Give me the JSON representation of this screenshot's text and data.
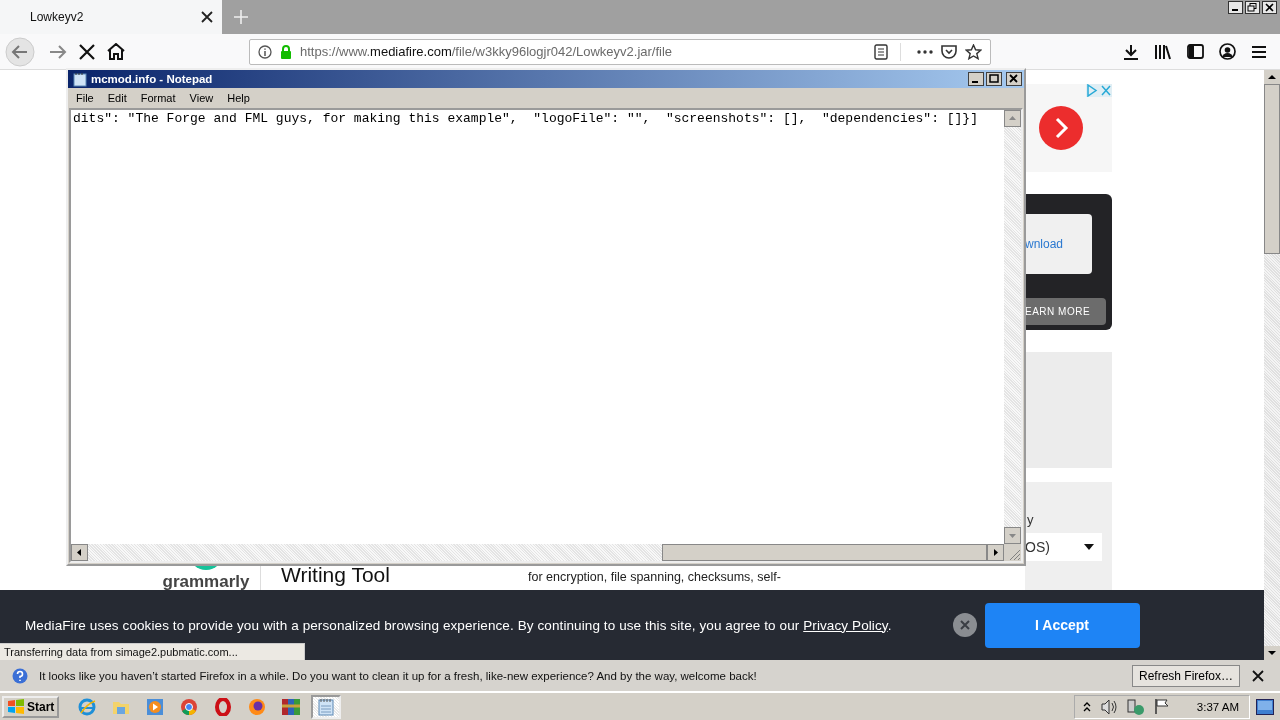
{
  "browser": {
    "tab": {
      "title": "Lowkeyv2"
    },
    "loading": true,
    "url": {
      "prefix": "https://www.",
      "domain": "mediafire.com",
      "path": "/file/w3kky96logjr042/Lowkeyv2.jar/file"
    }
  },
  "page": {
    "sidebar": {
      "ad_link": "wnload",
      "learn_more": "EARN MORE",
      "fragment": "y",
      "select_value": "OS)"
    },
    "main": {
      "logo": "grammarly",
      "heading": "Writing Tool",
      "text": "for encryption, file spanning, checksums, self-"
    }
  },
  "notepad": {
    "title": "mcmod.info - Notepad",
    "menu": [
      "File",
      "Edit",
      "Format",
      "View",
      "Help"
    ],
    "content": "dits\": \"The Forge and FML guys, for making this example\",  \"logoFile\": \"\",  \"screenshots\": [],  \"dependencies\": []}]"
  },
  "cookie_banner": {
    "text": "MediaFire uses cookies to provide you with a personalized browsing experience. By continuing to use this site, you agree to our ",
    "link": "Privacy Policy",
    "end": ".",
    "button": "I Accept"
  },
  "status": "Transferring data from simage2.pubmatic.com...",
  "notification": {
    "text": "It looks like you haven’t started Firefox in a while. Do you want to clean it up for a fresh, like-new experience? And by the way, welcome back!",
    "button": "Refresh Firefox…"
  },
  "taskbar": {
    "start": "Start",
    "clock": "3:37 AM",
    "apps": [
      {
        "kind": "ie",
        "selected": false
      },
      {
        "kind": "explorer",
        "selected": false
      },
      {
        "kind": "media",
        "selected": false
      },
      {
        "kind": "chrome",
        "selected": false
      },
      {
        "kind": "opera",
        "selected": false
      },
      {
        "kind": "firefox",
        "selected": false
      },
      {
        "kind": "winrar",
        "selected": false
      },
      {
        "kind": "notepad",
        "selected": true
      }
    ]
  }
}
